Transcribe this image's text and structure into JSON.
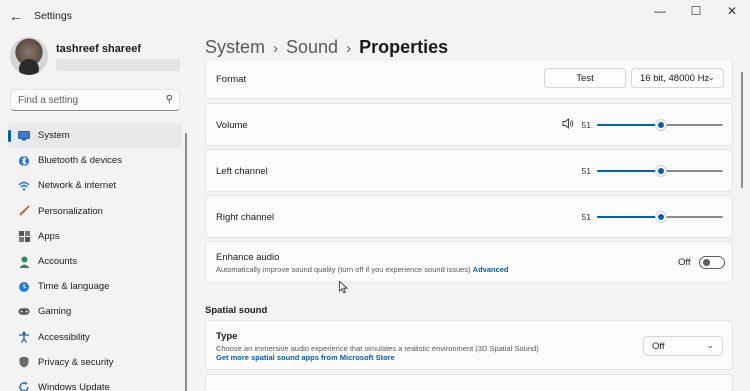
{
  "window": {
    "title": "Settings",
    "back_icon": "arrow-left",
    "controls": [
      "minimize",
      "maximize",
      "close"
    ]
  },
  "user": {
    "name": "tashreef shareef",
    "email": ""
  },
  "search": {
    "placeholder": "Find a setting"
  },
  "nav": [
    {
      "label": "System",
      "icon": "monitor",
      "active": true
    },
    {
      "label": "Bluetooth & devices",
      "icon": "bluetooth"
    },
    {
      "label": "Network & internet",
      "icon": "wifi"
    },
    {
      "label": "Personalization",
      "icon": "brush"
    },
    {
      "label": "Apps",
      "icon": "apps-grid"
    },
    {
      "label": "Accounts",
      "icon": "person"
    },
    {
      "label": "Time & language",
      "icon": "globe-clock"
    },
    {
      "label": "Gaming",
      "icon": "gamepad"
    },
    {
      "label": "Accessibility",
      "icon": "accessibility"
    },
    {
      "label": "Privacy & security",
      "icon": "shield"
    },
    {
      "label": "Windows Update",
      "icon": "refresh"
    }
  ],
  "breadcrumb": {
    "level1": "System",
    "level2": "Sound",
    "current": "Properties"
  },
  "format": {
    "label": "Format",
    "test_label": "Test",
    "selected": "16 bit, 48000 Hz"
  },
  "volume": {
    "label": "Volume",
    "value": "51",
    "level": 0.51
  },
  "left_channel": {
    "label": "Left channel",
    "value": "51",
    "level": 0.51
  },
  "right_channel": {
    "label": "Right channel",
    "value": "51",
    "level": 0.51
  },
  "enhance": {
    "title": "Enhance audio",
    "desc": "Automatically improve sound quality (turn off if you experience sound issues)",
    "link": "Advanced",
    "state": "Off"
  },
  "spatial": {
    "section_title": "Spatial sound",
    "title": "Type",
    "desc": "Choose an immersive audio experience that simulates a realistic environment (3D Spatial Sound)",
    "link": "Get more spatial sound apps from Microsoft Store",
    "selected": "Off"
  },
  "colors": {
    "accent": "#005fb8",
    "window_bg": "#f3f3f3",
    "card_bg": "#fbfbfb"
  }
}
